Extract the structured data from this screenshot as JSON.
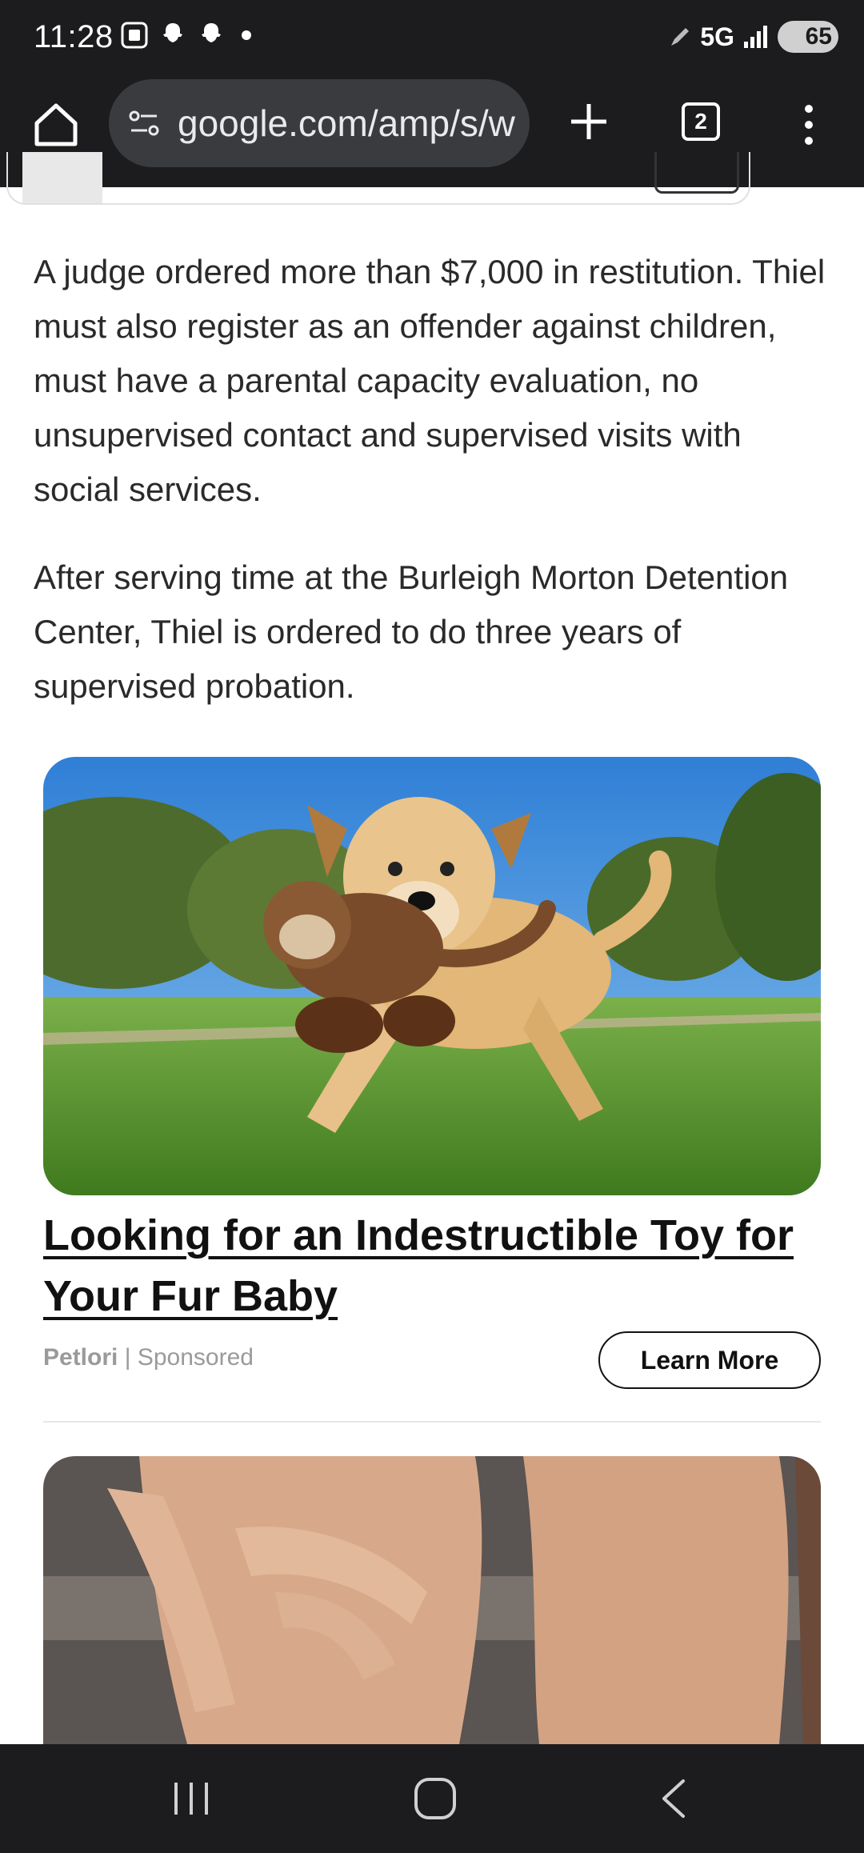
{
  "status_bar": {
    "time": "11:28",
    "network": "5G",
    "battery": "65"
  },
  "browser": {
    "url": "google.com/amp/s/w",
    "tab_count": "2"
  },
  "article": {
    "paragraphs": [
      "A judge ordered more than $7,000 in restitution. Thiel must also register as an offender against children, must have a parental capacity evaluation, no unsupervised contact and supervised visits with social services.",
      "After serving time at the Burleigh Morton Detention Center, Thiel is ordered to do three years of supervised probation."
    ]
  },
  "ad": {
    "title": "Looking for an Indestructible Toy for Your Fur Baby",
    "brand": "Petlori",
    "separator": "|",
    "sponsored": "Sponsored",
    "cta": "Learn More"
  },
  "colors": {
    "system_bar": "#1c1c1e",
    "url_bar": "#3a3b3e",
    "text": "#2a2a2a",
    "meta": "#9a9a9a"
  }
}
